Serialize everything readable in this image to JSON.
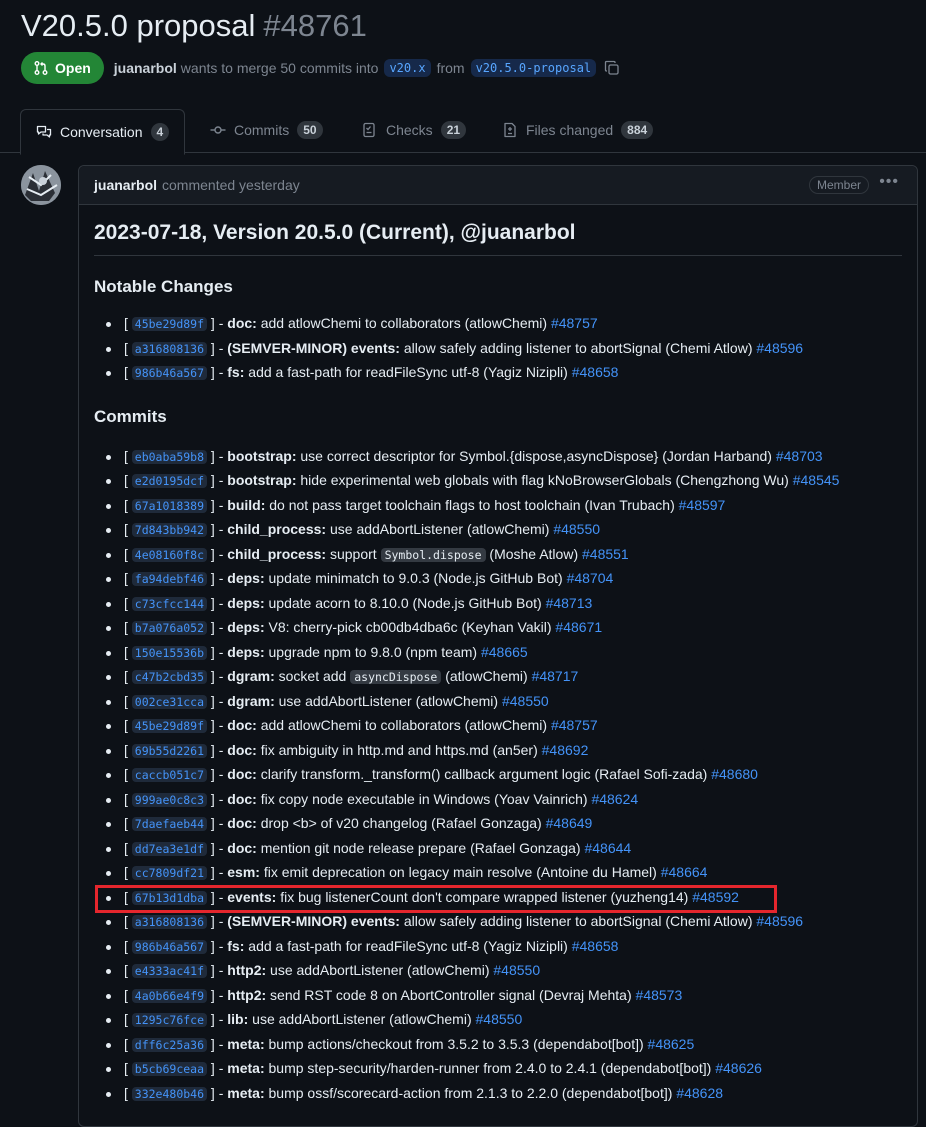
{
  "pr": {
    "title": "V20.5.0 proposal",
    "number": "#48761",
    "state": "Open",
    "author": "juanarbol",
    "merge_text": "wants to merge 50 commits into",
    "base_branch": "v20.x",
    "from_text": "from",
    "head_branch": "v20.5.0-proposal"
  },
  "tabs": [
    {
      "label": "Conversation",
      "count": "4"
    },
    {
      "label": "Commits",
      "count": "50"
    },
    {
      "label": "Checks",
      "count": "21"
    },
    {
      "label": "Files changed",
      "count": "884"
    }
  ],
  "comment": {
    "author": "juanarbol",
    "meta": "commented yesterday",
    "role": "Member",
    "heading": "2023-07-18, Version 20.5.0 (Current), @juanarbol",
    "notable_title": "Notable Changes",
    "commits_title": "Commits"
  },
  "notable": [
    {
      "sha": "45be29d89f",
      "sub": "doc",
      "pre": "",
      "mid": "",
      "post": "add atlowChemi to collaborators (atlowChemi)",
      "pr": "#48757"
    },
    {
      "sha": "a316808136",
      "sub": "(SEMVER-MINOR) events",
      "pre": "",
      "mid": "",
      "post": "allow safely adding listener to abortSignal (Chemi Atlow)",
      "pr": "#48596"
    },
    {
      "sha": "986b46a567",
      "sub": "fs",
      "pre": "",
      "mid": "",
      "post": "add a fast-path for readFileSync utf-8 (Yagiz Nizipli)",
      "pr": "#48658"
    }
  ],
  "commits": [
    {
      "sha": "eb0aba59b8",
      "sub": "bootstrap",
      "pre": "",
      "mid": "",
      "post": "use correct descriptor for Symbol.{dispose,asyncDispose} (Jordan Harband)",
      "pr": "#48703"
    },
    {
      "sha": "e2d0195dcf",
      "sub": "bootstrap",
      "pre": "",
      "mid": "",
      "post": "hide experimental web globals with flag kNoBrowserGlobals (Chengzhong Wu)",
      "pr": "#48545"
    },
    {
      "sha": "67a1018389",
      "sub": "build",
      "pre": "",
      "mid": "",
      "post": "do not pass target toolchain flags to host toolchain (Ivan Trubach)",
      "pr": "#48597"
    },
    {
      "sha": "7d843bb942",
      "sub": "child_process",
      "pre": "",
      "mid": "",
      "post": "use addAbortListener (atlowChemi)",
      "pr": "#48550"
    },
    {
      "sha": "4e08160f8c",
      "sub": "child_process",
      "pre": "support",
      "mid": "Symbol.dispose",
      "post": "(Moshe Atlow)",
      "pr": "#48551"
    },
    {
      "sha": "fa94debf46",
      "sub": "deps",
      "pre": "",
      "mid": "",
      "post": "update minimatch to 9.0.3 (Node.js GitHub Bot)",
      "pr": "#48704"
    },
    {
      "sha": "c73cfcc144",
      "sub": "deps",
      "pre": "",
      "mid": "",
      "post": "update acorn to 8.10.0 (Node.js GitHub Bot)",
      "pr": "#48713"
    },
    {
      "sha": "b7a076a052",
      "sub": "deps",
      "pre": "",
      "mid": "",
      "post": "V8: cherry-pick cb00db4dba6c (Keyhan Vakil)",
      "pr": "#48671"
    },
    {
      "sha": "150e15536b",
      "sub": "deps",
      "pre": "",
      "mid": "",
      "post": "upgrade npm to 9.8.0 (npm team)",
      "pr": "#48665"
    },
    {
      "sha": "c47b2cbd35",
      "sub": "dgram",
      "pre": "socket add",
      "mid": "asyncDispose",
      "post": "(atlowChemi)",
      "pr": "#48717"
    },
    {
      "sha": "002ce31cca",
      "sub": "dgram",
      "pre": "",
      "mid": "",
      "post": "use addAbortListener (atlowChemi)",
      "pr": "#48550"
    },
    {
      "sha": "45be29d89f",
      "sub": "doc",
      "pre": "",
      "mid": "",
      "post": "add atlowChemi to collaborators (atlowChemi)",
      "pr": "#48757"
    },
    {
      "sha": "69b55d2261",
      "sub": "doc",
      "pre": "",
      "mid": "",
      "post": "fix ambiguity in http.md and https.md (an5er)",
      "pr": "#48692"
    },
    {
      "sha": "caccb051c7",
      "sub": "doc",
      "pre": "",
      "mid": "",
      "post": "clarify transform._transform() callback argument logic (Rafael Sofi-zada)",
      "pr": "#48680"
    },
    {
      "sha": "999ae0c8c3",
      "sub": "doc",
      "pre": "",
      "mid": "",
      "post": "fix copy node executable in Windows (Yoav Vainrich)",
      "pr": "#48624"
    },
    {
      "sha": "7daefaeb44",
      "sub": "doc",
      "pre": "",
      "mid": "",
      "post": "drop <b> of v20 changelog (Rafael Gonzaga)",
      "pr": "#48649"
    },
    {
      "sha": "dd7ea3e1df",
      "sub": "doc",
      "pre": "",
      "mid": "",
      "post": "mention git node release prepare (Rafael Gonzaga)",
      "pr": "#48644"
    },
    {
      "sha": "cc7809df21",
      "sub": "esm",
      "pre": "",
      "mid": "",
      "post": "fix emit deprecation on legacy main resolve (Antoine du Hamel)",
      "pr": "#48664"
    },
    {
      "sha": "67b13d1dba",
      "sub": "events",
      "pre": "",
      "mid": "",
      "post": "fix bug listenerCount don't compare wrapped listener (yuzheng14)",
      "pr": "#48592"
    },
    {
      "sha": "a316808136",
      "sub": "(SEMVER-MINOR) events",
      "pre": "",
      "mid": "",
      "post": "allow safely adding listener to abortSignal (Chemi Atlow)",
      "pr": "#48596"
    },
    {
      "sha": "986b46a567",
      "sub": "fs",
      "pre": "",
      "mid": "",
      "post": "add a fast-path for readFileSync utf-8 (Yagiz Nizipli)",
      "pr": "#48658"
    },
    {
      "sha": "e4333ac41f",
      "sub": "http2",
      "pre": "",
      "mid": "",
      "post": "use addAbortListener (atlowChemi)",
      "pr": "#48550"
    },
    {
      "sha": "4a0b66e4f9",
      "sub": "http2",
      "pre": "",
      "mid": "",
      "post": "send RST code 8 on AbortController signal (Devraj Mehta)",
      "pr": "#48573"
    },
    {
      "sha": "1295c76fce",
      "sub": "lib",
      "pre": "",
      "mid": "",
      "post": "use addAbortListener (atlowChemi)",
      "pr": "#48550"
    },
    {
      "sha": "dff6c25a36",
      "sub": "meta",
      "pre": "",
      "mid": "",
      "post": "bump actions/checkout from 3.5.2 to 3.5.3 (dependabot[bot])",
      "pr": "#48625"
    },
    {
      "sha": "b5cb69ceaa",
      "sub": "meta",
      "pre": "",
      "mid": "",
      "post": "bump step-security/harden-runner from 2.4.0 to 2.4.1 (dependabot[bot])",
      "pr": "#48626"
    },
    {
      "sha": "332e480b46",
      "sub": "meta",
      "pre": "",
      "mid": "",
      "post": "bump ossf/scorecard-action from 2.1.3 to 2.2.0 (dependabot[bot])",
      "pr": "#48628"
    }
  ],
  "colors": {
    "accent": "#4493f8",
    "open": "#238636",
    "highlight": "#e5262d"
  }
}
